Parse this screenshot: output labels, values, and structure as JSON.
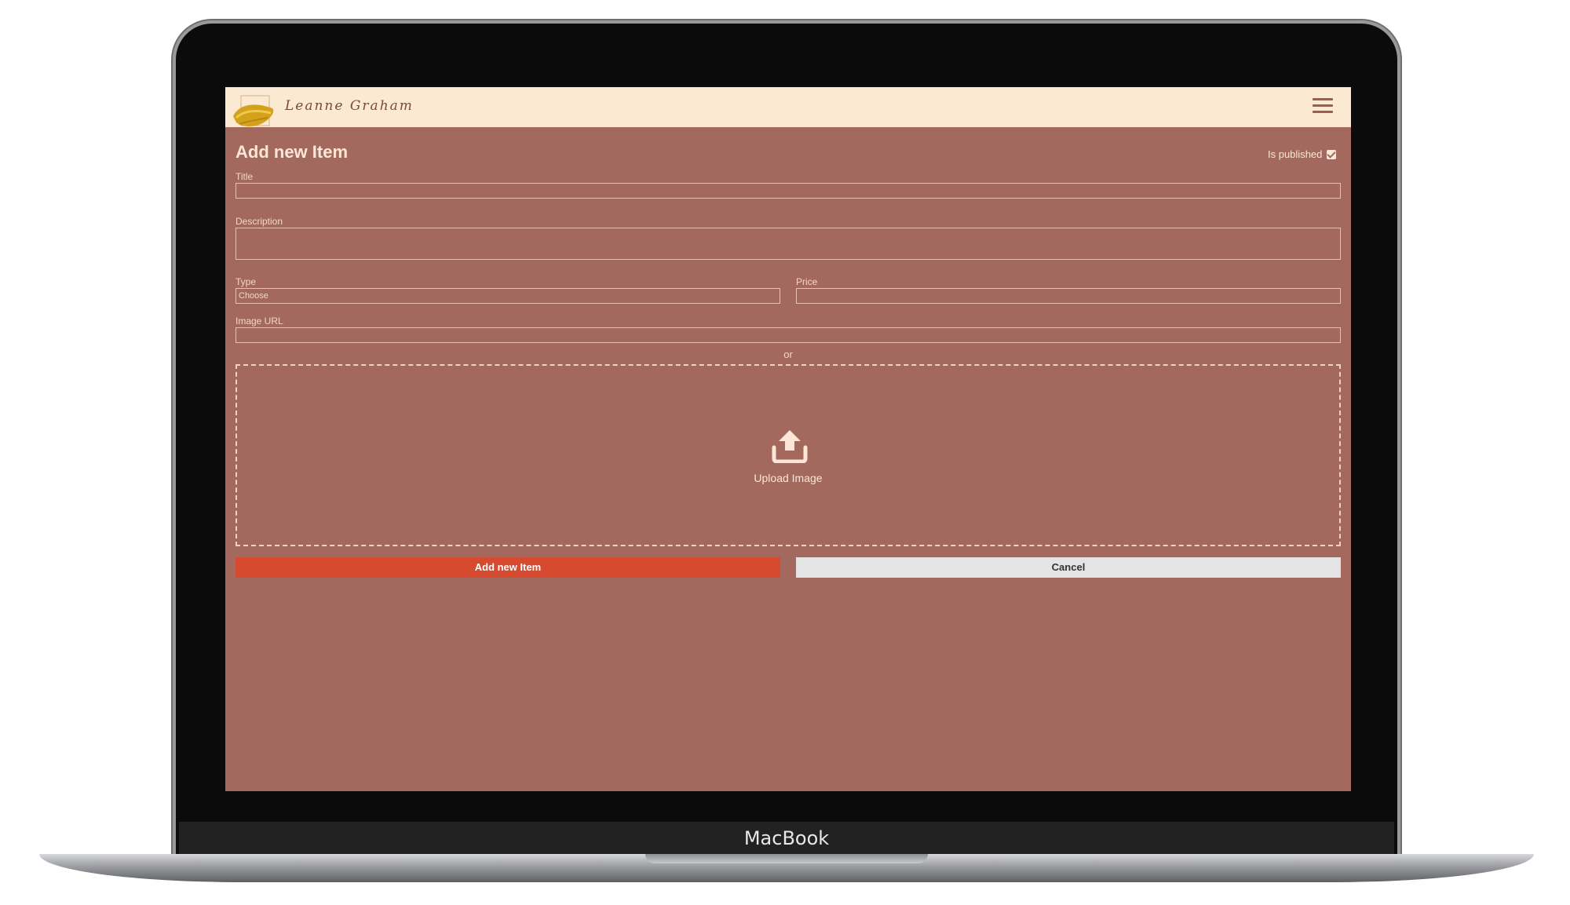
{
  "device": {
    "brand_label": "MacBook"
  },
  "header": {
    "logo_text": "Leanne Graham",
    "menu_icon": "hamburger-menu-icon"
  },
  "form": {
    "title": "Add new Item",
    "is_published_label": "Is published",
    "is_published_checked": true,
    "fields": {
      "title_label": "Title",
      "title_value": "",
      "description_label": "Description",
      "description_value": "",
      "type_label": "Type",
      "type_selected": "Choose",
      "price_label": "Price",
      "price_value": "",
      "image_url_label": "Image URL",
      "image_url_value": ""
    },
    "or_text": "or",
    "upload": {
      "icon": "upload-icon",
      "label": "Upload Image"
    },
    "buttons": {
      "submit_label": "Add new Item",
      "cancel_label": "Cancel"
    }
  },
  "colors": {
    "page_background": "#a3695e",
    "header_background": "#fce9d4",
    "primary_button": "#d64a2f",
    "secondary_button": "#e4e4e4"
  }
}
